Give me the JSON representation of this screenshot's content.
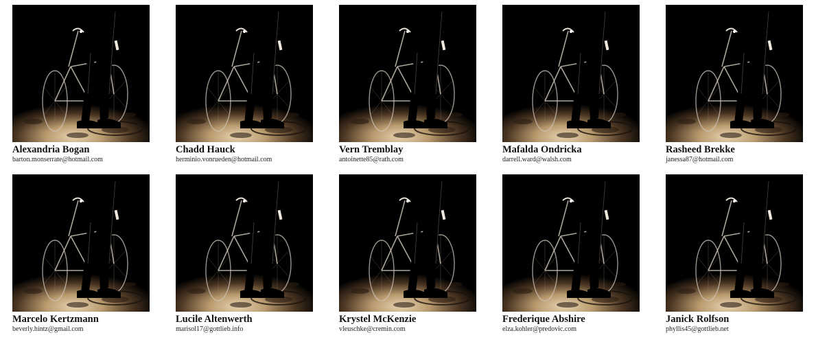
{
  "cards": [
    {
      "name": "Alexandria Bogan",
      "email": "barton.monserrate@hotmail.com"
    },
    {
      "name": "Chadd Hauck",
      "email": "herminio.vonrueden@hotmail.com"
    },
    {
      "name": "Vern Tremblay",
      "email": "antoinette85@rath.com"
    },
    {
      "name": "Mafalda Ondricka",
      "email": "darrell.ward@walsh.com"
    },
    {
      "name": "Rasheed Brekke",
      "email": "janessa87@hotmail.com"
    },
    {
      "name": "Marcelo Kertzmann",
      "email": "beverly.hintz@gmail.com"
    },
    {
      "name": "Lucile Altenwerth",
      "email": "marisol17@gottlieb.info"
    },
    {
      "name": "Krystel McKenzie",
      "email": "vleuschke@cremin.com"
    },
    {
      "name": "Frederique Abshire",
      "email": "elza.kohler@predovic.com"
    },
    {
      "name": "Janick Rolfson",
      "email": "phyllis45@gottlieb.net"
    }
  ],
  "photo_icon": "bicycle-silhouette-photo",
  "colors": {
    "photo_background": "#000000",
    "ground_light": "#d9c3a0",
    "text": "#111111"
  }
}
